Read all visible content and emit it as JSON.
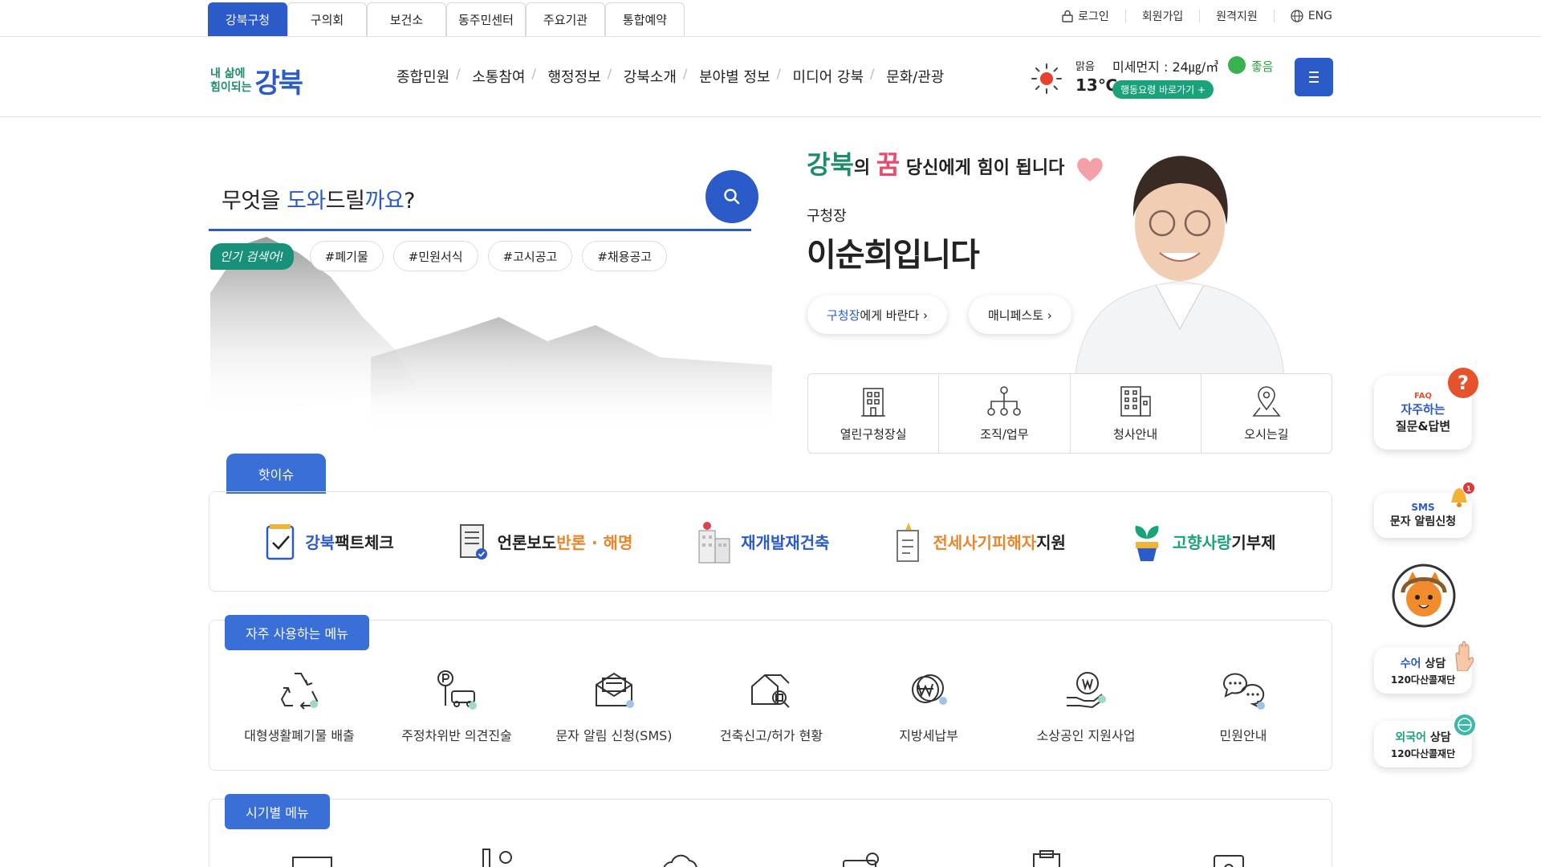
{
  "site_tabs": [
    "강북구청",
    "구의회",
    "보건소",
    "동주민센터",
    "주요기관",
    "통합예약"
  ],
  "util_links": {
    "login": "로그인",
    "join": "회원가입",
    "remote": "원격지원",
    "lang": "ENG"
  },
  "logo": {
    "sub_line1": "내 삶에",
    "sub_line2": "힘이되는",
    "main": "강북"
  },
  "gnb": [
    "종합민원",
    "소통참여",
    "행정정보",
    "강북소개",
    "분야별 정보",
    "미디어 강북",
    "문화/관광"
  ],
  "weather": {
    "condition": "맑음",
    "temp": "13℃",
    "dust_label": "미세먼지 : 24㎍/㎥",
    "dust_status": "좋음",
    "guide": "행동요령 바로가기 +"
  },
  "search": {
    "prefix": "무엇을 ",
    "hl1": "도와",
    "mid": "드릴",
    "hl2": "까요",
    "suffix": "?"
  },
  "popular": {
    "label": "인기 검색어!",
    "tags": [
      "#폐기물",
      "#민원서식",
      "#고시공고",
      "#채용공고"
    ]
  },
  "mayor": {
    "slogan_g1": "강북",
    "slogan_mid": "의 ",
    "slogan_g2": "꿈",
    "slogan_rest": " 당신에게 힘이 됩니다",
    "title": "구청장",
    "name": "이순희입니다",
    "btn1_hl": "구청장",
    "btn1_rest": "에게 바란다 ›",
    "btn2": "매니페스토 ›"
  },
  "office_links": [
    "열린구청장실",
    "조직/업무",
    "청사안내",
    "오시는길"
  ],
  "hot_issue": {
    "tab": "핫이슈",
    "items": [
      {
        "a": "강북",
        "b": "팩트체크"
      },
      {
        "a": "언론보도 ",
        "b": "반론 · 해명"
      },
      {
        "a": "재개발재건축",
        "b": ""
      },
      {
        "a": "전세사기피해자",
        "b": "지원"
      },
      {
        "a": "고향사랑",
        "b": "기부제"
      }
    ]
  },
  "frequent": {
    "tab": "자주 사용하는 메뉴",
    "items": [
      "대형생활폐기물 배출",
      "주정차위반 의견진술",
      "문자 알림 신청(SMS)",
      "건축신고/허가 현황",
      "지방세납부",
      "소상공인 지원사업",
      "민원안내"
    ]
  },
  "season": {
    "tab": "시기별 메뉴"
  },
  "floating": {
    "faq_small": "FAQ",
    "faq_line1": "자주하는",
    "faq_line2": "질문&답변",
    "sms_small": "SMS",
    "sms_line": "문자 알림신청",
    "sms_count": "1",
    "sign_line1_a": "수어",
    "sign_line1_b": " 상담",
    "sign_line2": "120다산콜재단",
    "foreign_line1_a": "외국어",
    "foreign_line1_b": " 상담",
    "foreign_line2": "120다산콜재단"
  },
  "colors": {
    "primary": "#2b5bc9",
    "green": "#1aa37a",
    "orange": "#e9862a"
  }
}
